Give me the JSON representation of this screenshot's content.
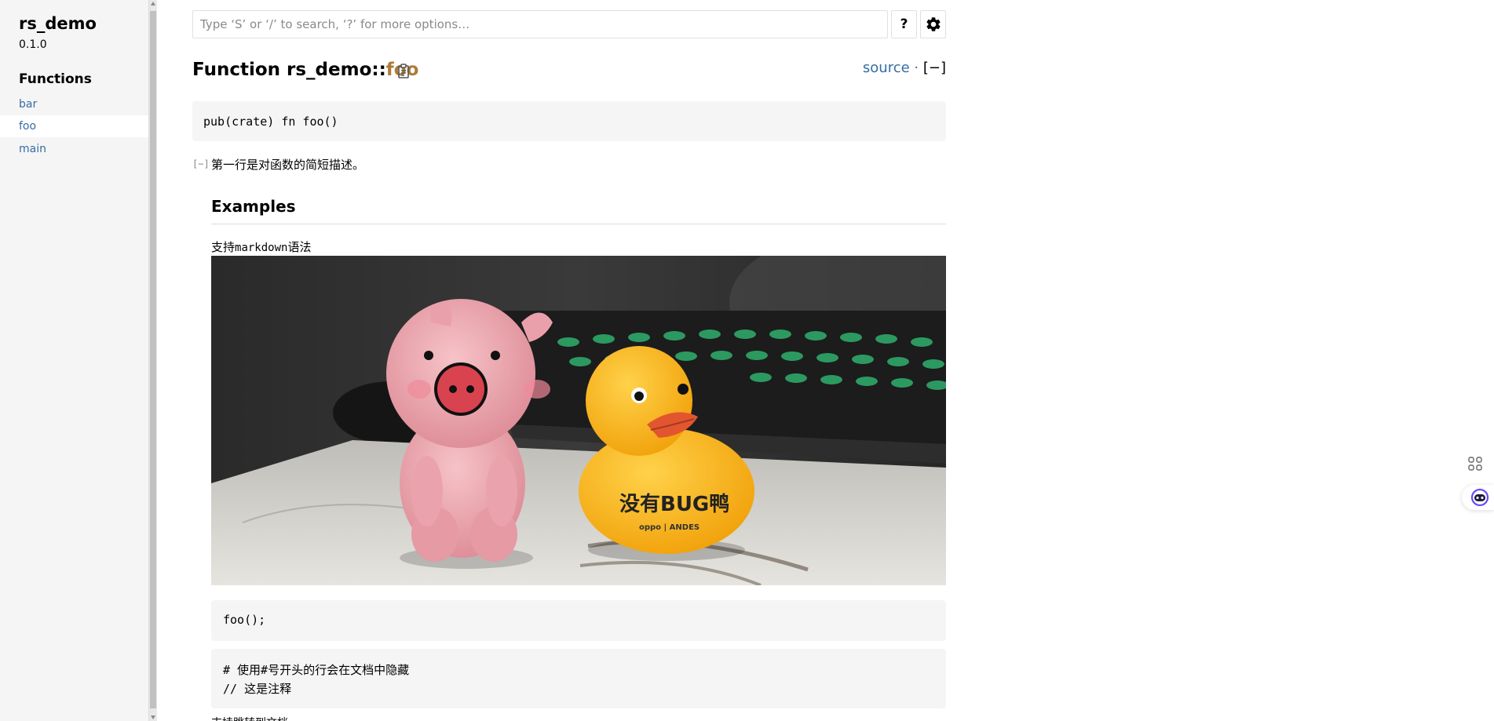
{
  "sidebar": {
    "crate_name": "rs_demo",
    "version": "0.1.0",
    "heading": "Functions",
    "items": [
      {
        "label": "bar",
        "current": false
      },
      {
        "label": "foo",
        "current": true
      },
      {
        "label": "main",
        "current": false
      }
    ]
  },
  "search": {
    "placeholder": "Type ‘S’ or ‘/’ to search, ‘?’ for more options…",
    "help_label": "?"
  },
  "header": {
    "title_prefix": "Function rs_demo::",
    "title_fn": "foo",
    "source_label": "source",
    "separator": " · ",
    "toggle_label": "[−]"
  },
  "signature": "pub(crate) fn foo()",
  "doc": {
    "collapse_toggle": "[−]",
    "short": "第一行是对函数的简短描述。",
    "examples_heading": "Examples",
    "md_prefix": "支持",
    "md_code": "markdown",
    "md_suffix": "语法",
    "photo_caption_text": "没有BUG鸭",
    "photo_brand_text": "oppo | ANDES",
    "example1": "foo();",
    "example2_line1": "# 使用#号开头的行会在文档中隐藏",
    "example2_line2": "// 这是注释",
    "cut_text": "支持跳转到文档"
  },
  "colors": {
    "link": "#356da4",
    "fn_name": "#ad7c37",
    "sidebar_bg": "#f5f5f5",
    "code_bg": "#f5f5f5"
  },
  "icons": {
    "settings": "gear-icon",
    "copy": "clipboard-icon",
    "grid": "grid-icon",
    "assistant": "bot-icon"
  }
}
